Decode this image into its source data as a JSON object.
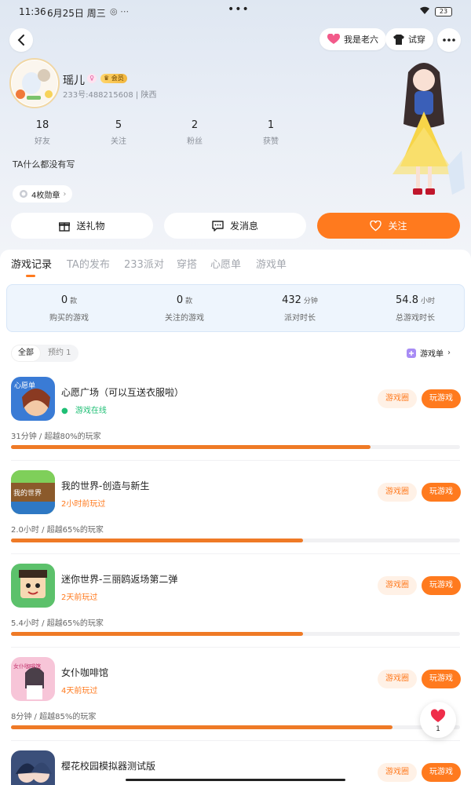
{
  "status_bar": {
    "time": "11:36",
    "date": "6月25日 周三",
    "extra": "⋯",
    "top_dots": "•••",
    "battery": "23"
  },
  "top_bar": {
    "badge_label": "我是老六",
    "tryon_label": "试穿"
  },
  "profile": {
    "name": "瑶儿",
    "gender_mark": "♀",
    "vip_label": "会员",
    "id_line": "233号:488215608 | 陕西",
    "bio": "TA什么都没有写",
    "medals": "4枚勋章"
  },
  "stats": [
    {
      "value": "18",
      "label": "好友"
    },
    {
      "value": "5",
      "label": "关注"
    },
    {
      "value": "2",
      "label": "粉丝"
    },
    {
      "value": "1",
      "label": "获赞"
    }
  ],
  "actions": {
    "gift": "送礼物",
    "message": "发消息",
    "follow": "关注"
  },
  "tabs": [
    "游戏记录",
    "TA的发布",
    "233派对",
    "穿搭",
    "心愿单",
    "游戏单"
  ],
  "summary": [
    {
      "value": "0",
      "unit": "款",
      "label": "购买的游戏"
    },
    {
      "value": "0",
      "unit": "款",
      "label": "关注的游戏"
    },
    {
      "value": "432",
      "unit": "分钟",
      "label": "派对时长"
    },
    {
      "value": "54.8",
      "unit": "小时",
      "label": "总游戏时长"
    }
  ],
  "filters": {
    "all": "全部",
    "reserved": "预约 1",
    "gamelist": "游戏单"
  },
  "games": [
    {
      "name": "心愿广场（可以互送衣服啦）",
      "status": "游戏在线",
      "online": true,
      "meta": "31分钟 / 超越80%的玩家",
      "progress": 0.8,
      "circle": "游戏圈",
      "play": "玩游戏",
      "icon_text": "心愿单",
      "color": "#3a7bd5"
    },
    {
      "name": "我的世界-创造与新生",
      "status": "2小时前玩过",
      "online": false,
      "meta": "2.0小时 / 超越65%的玩家",
      "progress": 0.65,
      "circle": "游戏圈",
      "play": "玩游戏",
      "icon_text": "我的世界",
      "color": "#6aa84f"
    },
    {
      "name": "迷你世界-三丽鸥返场第二弹",
      "status": "2天前玩过",
      "online": false,
      "meta": "5.4小时 / 超越65%的玩家",
      "progress": 0.65,
      "circle": "游戏圈",
      "play": "玩游戏",
      "icon_text": "",
      "color": "#5cc16b"
    },
    {
      "name": "女仆咖啡馆",
      "status": "4天前玩过",
      "online": false,
      "meta": "8分钟 / 超越85%的玩家",
      "progress": 0.85,
      "circle": "游戏圈",
      "play": "玩游戏",
      "icon_text": "女仆咖啡馆",
      "color": "#f7c5d8"
    },
    {
      "name": "樱花校园模拟器测试版",
      "status": "",
      "online": false,
      "meta": "",
      "progress": 0,
      "circle": "游戏圈",
      "play": "玩游戏",
      "icon_text": "",
      "color": "#3b4f7a"
    }
  ],
  "like_fab": {
    "count": "1"
  },
  "colors": {
    "accent": "#ff7a1e",
    "online": "#1fbf75"
  }
}
